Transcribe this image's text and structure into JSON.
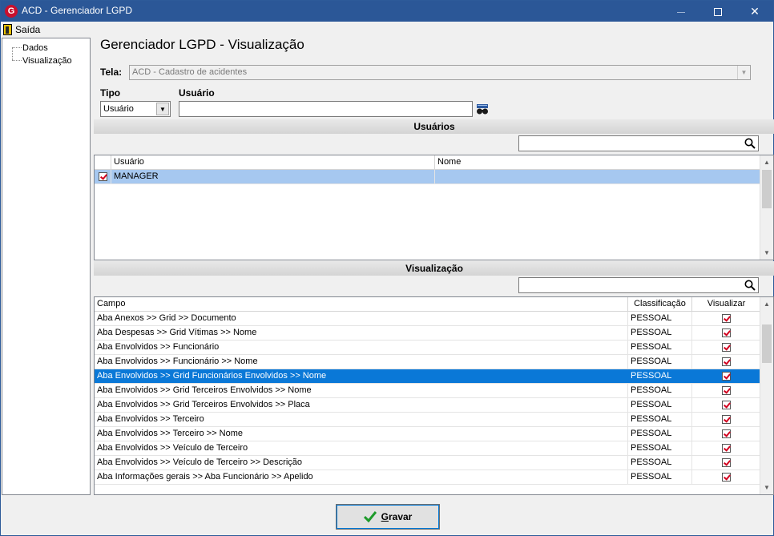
{
  "window": {
    "title": "ACD - Gerenciador LGPD"
  },
  "menu": {
    "saida": "Saída"
  },
  "tree": {
    "items": [
      "Dados",
      "Visualização"
    ]
  },
  "page": {
    "heading": "Gerenciador LGPD - Visualização"
  },
  "tela": {
    "label": "Tela:",
    "value": "ACD - Cadastro de acidentes"
  },
  "tipo": {
    "label": "Tipo",
    "value": "Usuário"
  },
  "usuario": {
    "label": "Usuário",
    "value": ""
  },
  "usuarios_section": {
    "title": "Usuários",
    "search_value": "",
    "columns": [
      "Usuário",
      "Nome"
    ],
    "rows": [
      {
        "checked": true,
        "usuario": "MANAGER",
        "nome": ""
      }
    ]
  },
  "visualizacao_section": {
    "title": "Visualização",
    "search_value": "",
    "columns": [
      "Campo",
      "Classificação",
      "Visualizar"
    ],
    "rows": [
      {
        "campo": "Aba Anexos >> Grid >> Documento",
        "classificacao": "PESSOAL",
        "visualizar": true
      },
      {
        "campo": "Aba Despesas >> Grid Vítimas >> Nome",
        "classificacao": "PESSOAL",
        "visualizar": true
      },
      {
        "campo": "Aba Envolvidos >> Funcionário",
        "classificacao": "PESSOAL",
        "visualizar": true
      },
      {
        "campo": "Aba Envolvidos >> Funcionário >> Nome",
        "classificacao": "PESSOAL",
        "visualizar": true
      },
      {
        "campo": "Aba Envolvidos >> Grid Funcionários Envolvidos >> Nome",
        "classificacao": "PESSOAL",
        "visualizar": true
      },
      {
        "campo": "Aba Envolvidos >> Grid Terceiros Envolvidos >> Nome",
        "classificacao": "PESSOAL",
        "visualizar": true
      },
      {
        "campo": "Aba Envolvidos >> Grid Terceiros Envolvidos >> Placa",
        "classificacao": "PESSOAL",
        "visualizar": true
      },
      {
        "campo": "Aba Envolvidos >> Terceiro",
        "classificacao": "PESSOAL",
        "visualizar": true
      },
      {
        "campo": "Aba Envolvidos >> Terceiro >> Nome",
        "classificacao": "PESSOAL",
        "visualizar": true
      },
      {
        "campo": "Aba Envolvidos >> Veículo de Terceiro",
        "classificacao": "PESSOAL",
        "visualizar": true
      },
      {
        "campo": "Aba Envolvidos >> Veículo de Terceiro >> Descrição",
        "classificacao": "PESSOAL",
        "visualizar": true
      },
      {
        "campo": "Aba Informações gerais >> Aba Funcionário >> Apelido",
        "classificacao": "PESSOAL",
        "visualizar": true
      }
    ],
    "selected_row": 4
  },
  "footer": {
    "gravar_prefix": "G",
    "gravar_rest": "ravar"
  },
  "colors": {
    "titlebar": "#2b5797",
    "selection": "#0a78d7",
    "check": "#d1001f"
  }
}
